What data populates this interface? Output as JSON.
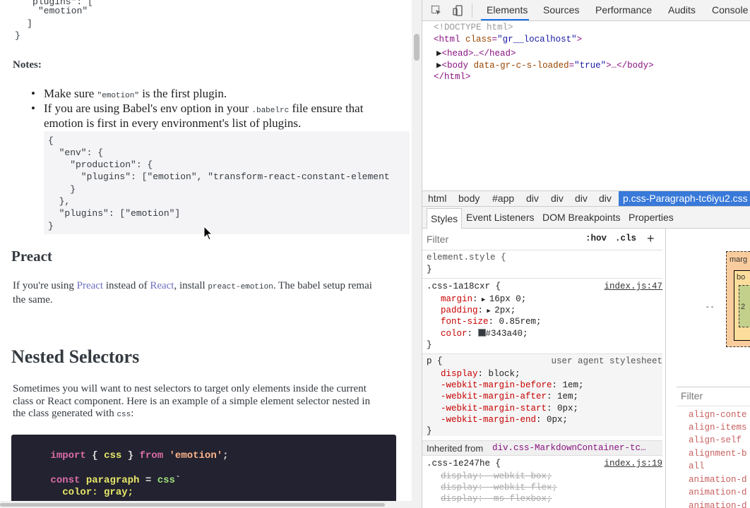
{
  "doc": {
    "top_code": {
      "plugins_fragment": "plugins\": [",
      "emotion_line": "\"emotion\"",
      "close_bracket": "]",
      "close_brace": "}"
    },
    "notes_label": "Notes:",
    "bullet1": {
      "pre": "Make sure ",
      "code": "\"emotion\"",
      "post": " is the first plugin."
    },
    "bullet2": {
      "pre": "If you are using Babel's env option in your ",
      "code": ".babelrc",
      "post": " file ensure that",
      "line2": "emotion is first in every environment's list of plugins."
    },
    "env_code": [
      "{",
      "  \"env\": {",
      "    \"production\": {",
      "      \"plugins\": [\"emotion\", \"transform-react-constant-element",
      "    }",
      "  },",
      "  \"plugins\": [\"emotion\"]",
      "}"
    ],
    "preact_heading": "Preact",
    "preact_para": {
      "p1": "If you're using ",
      "link1": "Preact",
      "p2": " instead of ",
      "link2": "React",
      "p3": ", install ",
      "code": "preact-emotion",
      "p4": ". The babel setup remai",
      "line2": "the same."
    },
    "nested_heading": "Nested Selectors",
    "nested_para": {
      "line1": "Sometimes you will want to nest selectors to target only elements inside the current",
      "line2": "class or React component. Here is an example of a simple element selector nested in",
      "line3_pre": "the class generated with ",
      "line3_code": "css",
      "line3_post": ":"
    },
    "dark_code": {
      "l1": {
        "kw1": "import",
        "pl1": " { ",
        "id1": "css",
        "pl2": " } ",
        "kw2": "from",
        "pl3": " ",
        "str": "'emotion'",
        "pl4": ";"
      },
      "l2": {
        "kw": "const",
        "pl1": " ",
        "id": "paragraph",
        "pl2": " = ",
        "gr": "css",
        "pl3": "`"
      },
      "l3": {
        "id": "  color: gray;"
      }
    }
  },
  "devtools": {
    "tabs": [
      "Elements",
      "Sources",
      "Performance",
      "Audits",
      "Console"
    ],
    "active_tab": "Elements",
    "dom": {
      "doctype": "<!DOCTYPE html>",
      "html_open_tag": "<html",
      "html_attr": "class",
      "html_val": "\"gr__localhost\"",
      "html_close": ">",
      "head": "<head>…</head>",
      "body_tag": "<body",
      "body_attr": "data-gr-c-s-loaded",
      "body_val": "\"true\"",
      "body_rest": ">…</body>",
      "html_end": "</html>"
    },
    "breadcrumbs": [
      "html",
      "body",
      "#app",
      "div",
      "div",
      "div",
      "div"
    ],
    "breadcrumb_selected": "p.css-Paragraph-tc6iyu2.css",
    "subtabs": [
      "Styles",
      "Event Listeners",
      "DOM Breakpoints",
      "Properties"
    ],
    "filter_placeholder": "Filter",
    "hov": ":hov",
    "cls": ".cls",
    "plus": "+",
    "element_style": "element.style {",
    "close_brace": "}",
    "rule1": {
      "selector": ".css-1a18cxr {",
      "source": "index.js:47",
      "props": [
        {
          "name": "margin",
          "value": "16px 0;",
          "arrow": true
        },
        {
          "name": "padding",
          "value": "2px;",
          "arrow": true
        },
        {
          "name": "font-size",
          "value": "0.85rem;",
          "arrow": false
        },
        {
          "name": "color",
          "value": "#343a40;",
          "arrow": false,
          "swatch": "#343a40"
        }
      ]
    },
    "rule2": {
      "selector": "p {",
      "source": "user agent stylesheet",
      "props": [
        {
          "name": "display",
          "value": "block;"
        },
        {
          "name": "-webkit-margin-before",
          "value": "1em;"
        },
        {
          "name": "-webkit-margin-after",
          "value": "1em;"
        },
        {
          "name": "-webkit-margin-start",
          "value": "0px;"
        },
        {
          "name": "-webkit-margin-end",
          "value": "0px;"
        }
      ]
    },
    "inherited_label": "Inherited from",
    "inherited_from": "div.css-MarkdownContainer-tc…",
    "rule3": {
      "selector": ".css-1e247he {",
      "source": "index.js:19",
      "props": [
        "display: -webkit-box;",
        "display: -webkit-flex;",
        "display: -ms-flexbox;"
      ]
    },
    "boxmodel": {
      "margin": "marg",
      "border": "bo",
      "padding_val": "2"
    },
    "computed_filter": "Filter",
    "computed_props": [
      "align-conte",
      "align-items",
      "align-self",
      "alignment-b",
      "all",
      "animation-d",
      "animation-d",
      "animation-d"
    ]
  },
  "colors": {
    "accent": "#1a73e8",
    "crumb_selected": "#3879d9",
    "code_bg": "#222230"
  }
}
